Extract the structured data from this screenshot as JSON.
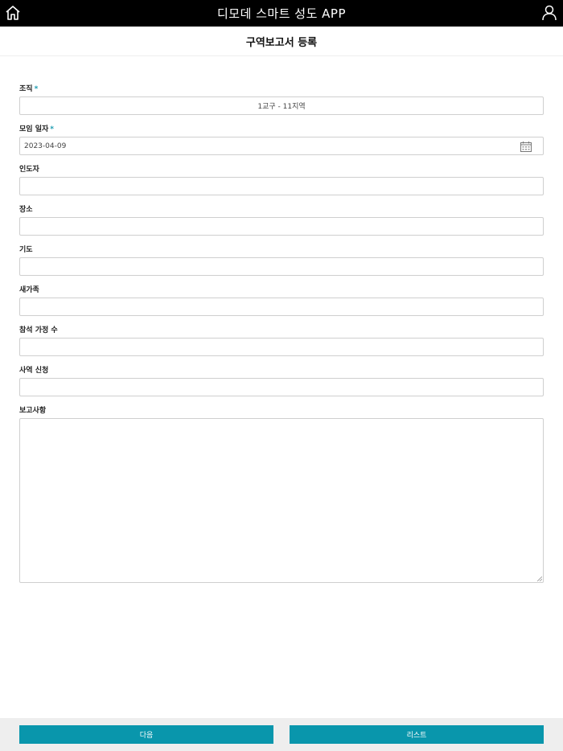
{
  "app": {
    "title": "디모데 스마트 성도 APP"
  },
  "page": {
    "title": "구역보고서 등록"
  },
  "form": {
    "org": {
      "label": "조직",
      "required_mark": "*",
      "value": "1교구 - 11지역"
    },
    "meeting_date": {
      "label": "모임 일자",
      "required_mark": "*",
      "value": "2023-04-09"
    },
    "leader": {
      "label": "인도자",
      "value": ""
    },
    "place": {
      "label": "장소",
      "value": ""
    },
    "prayer": {
      "label": "기도",
      "value": ""
    },
    "new_family": {
      "label": "새가족",
      "value": ""
    },
    "attending_households": {
      "label": "참석 가정 수",
      "value": ""
    },
    "ministry_request": {
      "label": "사역 신청",
      "value": ""
    },
    "report": {
      "label": "보고사항",
      "value": ""
    }
  },
  "actions": {
    "next_label": "다음",
    "list_label": "리스트"
  },
  "colors": {
    "accent": "#0996ac",
    "required": "#1a9bb0",
    "topbar": "#000000"
  },
  "icons": {
    "home": "home-icon",
    "user": "user-icon",
    "calendar": "calendar-icon"
  }
}
